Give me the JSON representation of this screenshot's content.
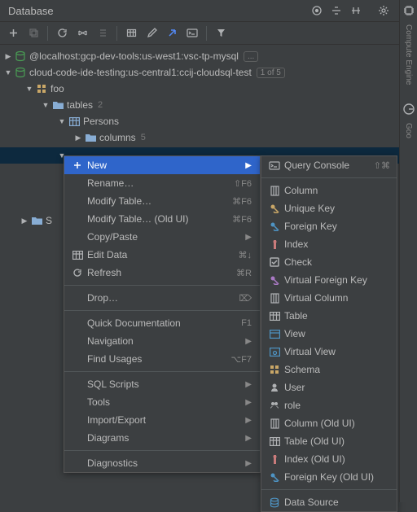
{
  "header": {
    "title": "Database"
  },
  "tree": {
    "ds1": "@localhost:gcp-dev-tools:us-west1:vsc-tp-mysql",
    "ds1_badge": "...",
    "ds2": "cloud-code-ide-testing:us-central1:ccij-cloudsql-test",
    "ds2_badge": "1 of 5",
    "schema": "foo",
    "tables_label": "tables",
    "tables_count": "2",
    "persons": "Persons",
    "columns_label": "columns",
    "columns_count": "5",
    "bottom": "S"
  },
  "menu": {
    "new": "New",
    "rename": "Rename…",
    "rename_sc": "⇧F6",
    "modify": "Modify Table…",
    "modify_sc": "⌘F6",
    "modify_old": "Modify Table… (Old UI)",
    "modify_old_sc": "⌘F6",
    "copypaste": "Copy/Paste",
    "edit_data": "Edit Data",
    "edit_data_sc": "⌘↓",
    "refresh": "Refresh",
    "refresh_sc": "⌘R",
    "drop": "Drop…",
    "drop_sc": "⌦",
    "quick_doc": "Quick Documentation",
    "quick_doc_sc": "F1",
    "navigation": "Navigation",
    "find_usages": "Find Usages",
    "find_usages_sc": "⌥F7",
    "sql_scripts": "SQL Scripts",
    "tools": "Tools",
    "import_export": "Import/Export",
    "diagrams": "Diagrams",
    "diagnostics": "Diagnostics"
  },
  "submenu": {
    "query_console": "Query Console",
    "query_console_sc": "⇧⌘",
    "column": "Column",
    "unique_key": "Unique Key",
    "foreign_key": "Foreign Key",
    "index": "Index",
    "check": "Check",
    "vfk": "Virtual Foreign Key",
    "vcol": "Virtual Column",
    "table": "Table",
    "view": "View",
    "vview": "Virtual View",
    "schema": "Schema",
    "user": "User",
    "role": "role",
    "col_old": "Column (Old UI)",
    "table_old": "Table (Old UI)",
    "index_old": "Index (Old UI)",
    "fk_old": "Foreign Key (Old UI)",
    "data_source": "Data Source"
  },
  "sidebar": {
    "compute": "Compute Engine",
    "goo": "Goo"
  }
}
